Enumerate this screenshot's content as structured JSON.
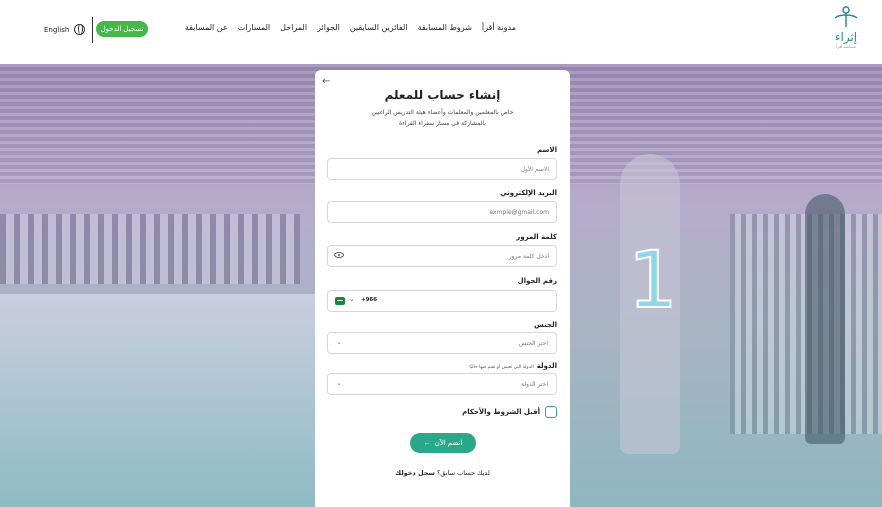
{
  "header": {
    "language_label": "English",
    "login_button": "تسجيل الدخول",
    "nav_items": [
      "عن المسابقة",
      "المسارات",
      "المراحل",
      "الجوائز",
      "الفائزين السابقين",
      "شروط المسابقة",
      "مدونة أقرأ"
    ],
    "logo_text": "إثراء",
    "logo_sub": "مسابقة أقرأ"
  },
  "background": {
    "overlay_number": "1"
  },
  "form": {
    "title": "إنشاء حساب للمعلم",
    "description_line1": "خاص بالمعلمين والمعلمات وأعضاء هيئة التدريس الراغبين",
    "description_line2": "بالمشاركة في مسار سفراء القراءة",
    "name_label": "الاسم",
    "name_placeholder": "الاسم الأول",
    "email_label": "البريد الإلكتروني",
    "email_placeholder": "exmple@gmail.com",
    "password_label": "كلمة المرور",
    "password_placeholder": "أدخل كلمة مرور",
    "phone_label": "رقم الجوال",
    "phone_code": "+966",
    "gender_label": "الجنس",
    "gender_placeholder": "اختر الجنس",
    "country_label": "الدولة",
    "country_hint": "الدولة التي تعيش أو تقيم فيها حاليًا",
    "country_placeholder": "اختر الدولة",
    "terms_label": "أقبل الشروط والأحكام",
    "submit_label": "انضم الآن",
    "have_account": "لديك حساب سابق؟",
    "login_link": "سجل دخولك"
  },
  "colors": {
    "primary_green": "#45b849",
    "teal_button": "#2aa98a"
  }
}
